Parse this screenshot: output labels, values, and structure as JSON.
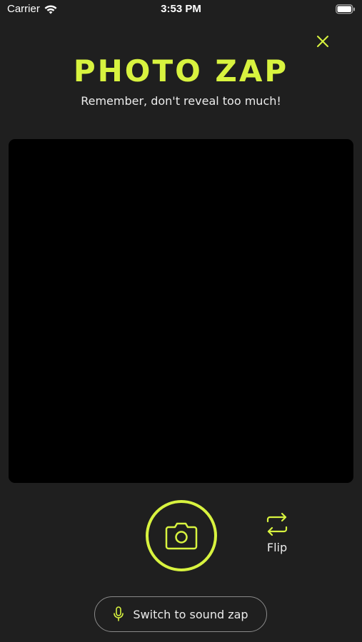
{
  "status_bar": {
    "carrier": "Carrier",
    "time": "3:53 PM"
  },
  "header": {
    "title": "PHOTO ZAP",
    "subtitle": "Remember, don't reveal too much!"
  },
  "controls": {
    "flip_label": "Flip",
    "sound_zap_label": "Switch to sound zap"
  },
  "icons": {
    "close": "close-icon",
    "shutter": "camera-icon",
    "flip": "flip-icon",
    "microphone": "microphone-icon",
    "wifi": "wifi-icon",
    "battery": "battery-icon"
  },
  "colors": {
    "accent": "#d8f33f",
    "background": "#1f1f1f",
    "preview": "#000000"
  }
}
